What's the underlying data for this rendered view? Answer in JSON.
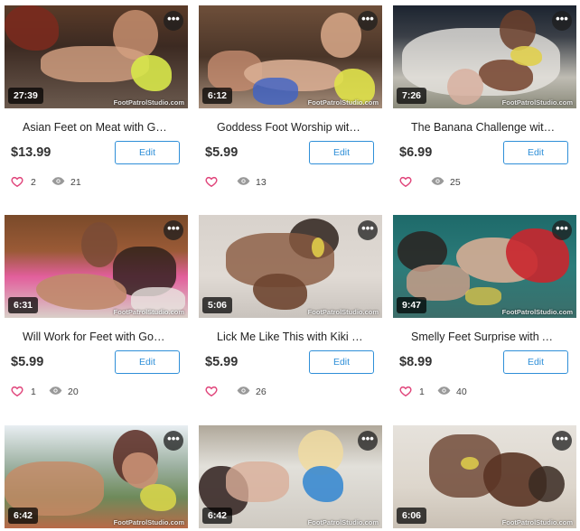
{
  "ui": {
    "edit_label": "Edit",
    "more_label": "•••",
    "watermark": "FootPatrolStudio.com",
    "colors": {
      "accent": "#2f8fd8",
      "heart": "#e0457b"
    }
  },
  "cards": [
    {
      "duration": "27:39",
      "title": "Asian Feet on Meat with Godd…",
      "price": "$13.99",
      "likes": "2",
      "views": "21"
    },
    {
      "duration": "6:12",
      "title": "Goddess Foot Worship with Go…",
      "price": "$5.99",
      "likes": "",
      "views": "13"
    },
    {
      "duration": "7:26",
      "title": "The Banana Challenge with Cla…",
      "price": "$6.99",
      "likes": "",
      "views": "25"
    },
    {
      "duration": "6:31",
      "title": "Will Work for Feet with Goddes…",
      "price": "$5.99",
      "likes": "1",
      "views": "20"
    },
    {
      "duration": "5:06",
      "title": "Lick Me Like This with Kiki Star",
      "price": "$5.99",
      "likes": "",
      "views": "26"
    },
    {
      "duration": "9:47",
      "title": "Smelly Feet Surprise with Ashl…",
      "price": "$8.99",
      "likes": "1",
      "views": "40"
    },
    {
      "duration": "6:42",
      "title": "",
      "price": "",
      "likes": "",
      "views": ""
    },
    {
      "duration": "6:42",
      "title": "",
      "price": "",
      "likes": "",
      "views": ""
    },
    {
      "duration": "6:06",
      "title": "",
      "price": "",
      "likes": "",
      "views": ""
    }
  ]
}
